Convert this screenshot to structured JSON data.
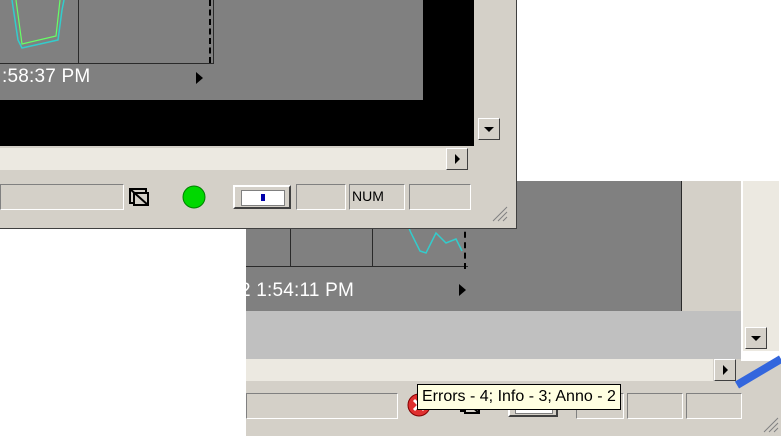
{
  "window_a": {
    "timestamp": ":58:37 PM",
    "status_bar": {
      "num_indicator": "NUM",
      "connection_color": "#00d800"
    }
  },
  "window_b": {
    "timestamp": "2 1:54:11 PM",
    "tooltip": "Errors - 4; Info - 3; Anno - 2"
  },
  "colors": {
    "plot_background": "#808080",
    "trace_cyan": "#33cccc",
    "trace_green": "#66ff66",
    "error_red": "#e03030",
    "highlight_blue": "#3366dd"
  },
  "icons": [
    "display-toggle-icon",
    "connection-status-icon",
    "panel-icon",
    "error-icon",
    "resize-grip-icon",
    "scroll-down-icon",
    "scroll-right-icon",
    "play-arrow-icon"
  ]
}
